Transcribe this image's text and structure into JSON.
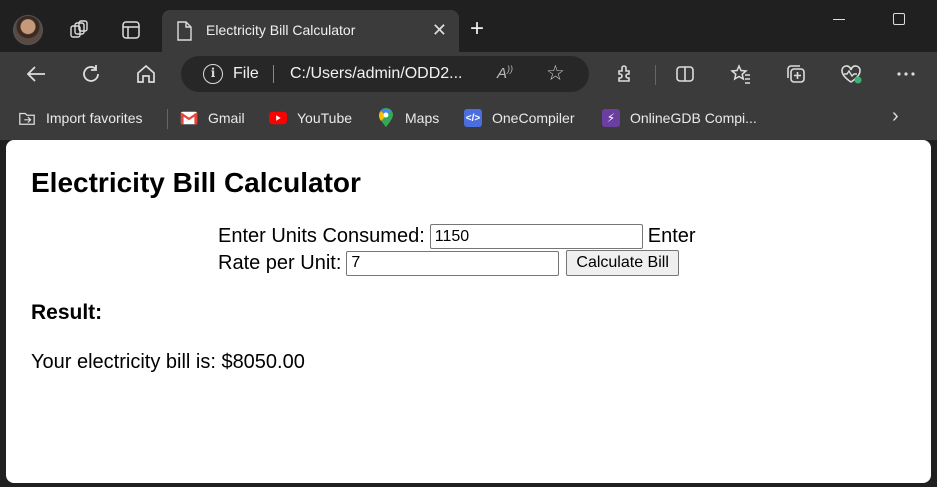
{
  "browser": {
    "tab": {
      "title": "Electricity Bill Calculator"
    },
    "address": {
      "scheme_label": "File",
      "url": "C:/Users/admin/ODD2..."
    },
    "favorites": [
      {
        "label": "Import favorites",
        "icon": "import-icon"
      },
      {
        "label": "Gmail",
        "icon": "gmail-icon",
        "color": "#ea4335"
      },
      {
        "label": "YouTube",
        "icon": "youtube-icon",
        "color": "#ff0000"
      },
      {
        "label": "Maps",
        "icon": "maps-icon",
        "color": "#34a853"
      },
      {
        "label": "OneCompiler",
        "icon": "onecompiler-icon",
        "color": "#4a6ee0"
      },
      {
        "label": "OnlineGDB Compi...",
        "icon": "onlinegdb-icon",
        "color": "#6a3fa0"
      }
    ]
  },
  "page": {
    "title": "Electricity Bill Calculator",
    "units_label": "Enter Units Consumed:",
    "units_value": "1150",
    "rate_label_part1": "Enter",
    "rate_label_part2": "Rate per Unit:",
    "rate_value": "7",
    "calculate_button": "Calculate Bill",
    "result_heading": "Result:",
    "result_text": "Your electricity bill is: $8050.00"
  }
}
